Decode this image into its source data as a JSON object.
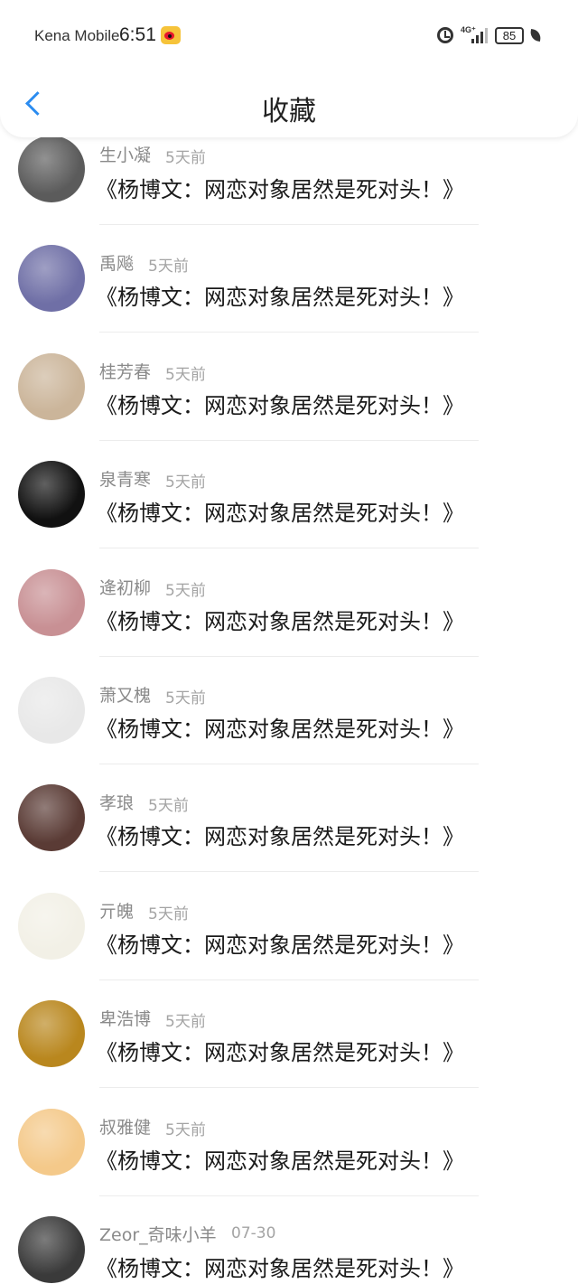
{
  "status_bar": {
    "carrier": "Kena Mobile",
    "time": "6:51",
    "network": "4G⁺",
    "battery": "85"
  },
  "header": {
    "title": "收藏"
  },
  "list": [
    {
      "name": "生小凝",
      "time": "5天前",
      "book": "《杨博文：网恋对象居然是死对头！》",
      "avatar_color": "#5b5b5b"
    },
    {
      "name": "禹飚",
      "time": "5天前",
      "book": "《杨博文：网恋对象居然是死对头！》",
      "avatar_color": "#6f6fa6"
    },
    {
      "name": "桂芳春",
      "time": "5天前",
      "book": "《杨博文：网恋对象居然是死对头！》",
      "avatar_color": "#cbb59a"
    },
    {
      "name": "泉青寒",
      "time": "5天前",
      "book": "《杨博文：网恋对象居然是死对头！》",
      "avatar_color": "#111111"
    },
    {
      "name": "逄初柳",
      "time": "5天前",
      "book": "《杨博文：网恋对象居然是死对头！》",
      "avatar_color": "#c89094"
    },
    {
      "name": "萧又槐",
      "time": "5天前",
      "book": "《杨博文：网恋对象居然是死对头！》",
      "avatar_color": "#e8e8e8"
    },
    {
      "name": "孝琅",
      "time": "5天前",
      "book": "《杨博文：网恋对象居然是死对头！》",
      "avatar_color": "#5a3b35"
    },
    {
      "name": "亓魄",
      "time": "5天前",
      "book": "《杨博文：网恋对象居然是死对头！》",
      "avatar_color": "#f2f0e6"
    },
    {
      "name": "卑浩博",
      "time": "5天前",
      "book": "《杨博文：网恋对象居然是死对头！》",
      "avatar_color": "#b9871e"
    },
    {
      "name": "叔雅健",
      "time": "5天前",
      "book": "《杨博文：网恋对象居然是死对头！》",
      "avatar_color": "#f4c98a"
    },
    {
      "name": "Zeor_奇味小羊",
      "time": "07-30",
      "book": "《杨博文：网恋对象居然是死对头！》",
      "avatar_color": "#3a3a3a"
    }
  ]
}
